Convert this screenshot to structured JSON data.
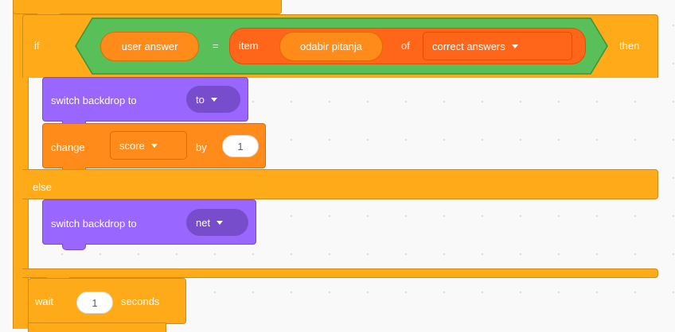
{
  "script": {
    "if_label": "if",
    "then_label": "then",
    "condition": {
      "left_reporter": "user answer",
      "operator": "=",
      "item_label": "item",
      "index_reporter": "odabir pitanja",
      "of_label": "of",
      "list_dropdown": "correct answers"
    },
    "then_blocks": {
      "switch_backdrop_label": "switch backdrop to",
      "switch_backdrop_value": "to",
      "change_label": "change",
      "change_variable": "score",
      "change_by_label": "by",
      "change_amount": "1"
    },
    "else_label": "else",
    "else_blocks": {
      "switch_backdrop_label": "switch backdrop to",
      "switch_backdrop_value": "net"
    },
    "wait_block": {
      "wait_label": "wait",
      "wait_value": "1",
      "seconds_label": "seconds"
    }
  },
  "colors": {
    "control": "#ffab19",
    "looks": "#9966ff",
    "operators": "#59c059",
    "variables": "#ff8c1a",
    "background": "#f9f9f9"
  }
}
